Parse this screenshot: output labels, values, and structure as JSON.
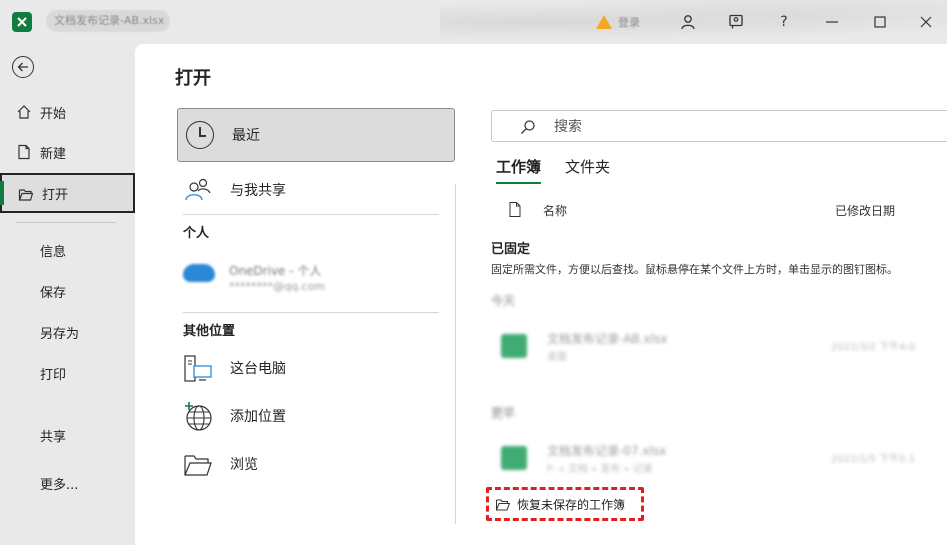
{
  "titlebar": {
    "doc_title": "文档发布记录-AB.xlsx",
    "account_text": "登录",
    "help_label": "?"
  },
  "nav": {
    "items": [
      {
        "label": "开始"
      },
      {
        "label": "新建"
      },
      {
        "label": "打开"
      },
      {
        "label": "信息"
      },
      {
        "label": "保存"
      },
      {
        "label": "另存为"
      },
      {
        "label": "打印"
      },
      {
        "label": "共享"
      },
      {
        "label": "更多..."
      }
    ]
  },
  "main": {
    "title": "打开",
    "locations": {
      "recent": "最近",
      "shared": "与我共享",
      "personal_head": "个人",
      "onedrive_name": "OneDrive - 个人",
      "onedrive_email": "********@qq.com",
      "other_head": "其他位置",
      "this_pc": "这台电脑",
      "add_place": "添加位置",
      "browse": "浏览"
    },
    "search": {
      "placeholder": "搜索"
    },
    "tabs": [
      {
        "label": "工作簿"
      },
      {
        "label": "文件夹"
      }
    ],
    "columns": {
      "name": "名称",
      "modified": "已修改日期"
    },
    "pinned": {
      "heading": "已固定",
      "description": "固定所需文件，方便以后查找。鼠标悬停在某个文件上方时，单击显示的图钉图标。"
    },
    "groups": [
      {
        "label": "今天",
        "files": [
          {
            "name": "文档发布记录-AB.xlsx",
            "path": "桌面",
            "date": "2022/3/2 下午4:0"
          }
        ]
      },
      {
        "label": "更早",
        "files": [
          {
            "name": "文档发布记录-07.xlsx",
            "path": "F: » 文档 » 发布 » 记录",
            "date": "2022/1/5 下午5:1"
          }
        ]
      }
    ],
    "recover_label": "恢复未保存的工作簿"
  },
  "colors": {
    "accent": "#107c41",
    "highlight_dashed": "#e02020",
    "onedrive": "#2b88d8"
  }
}
